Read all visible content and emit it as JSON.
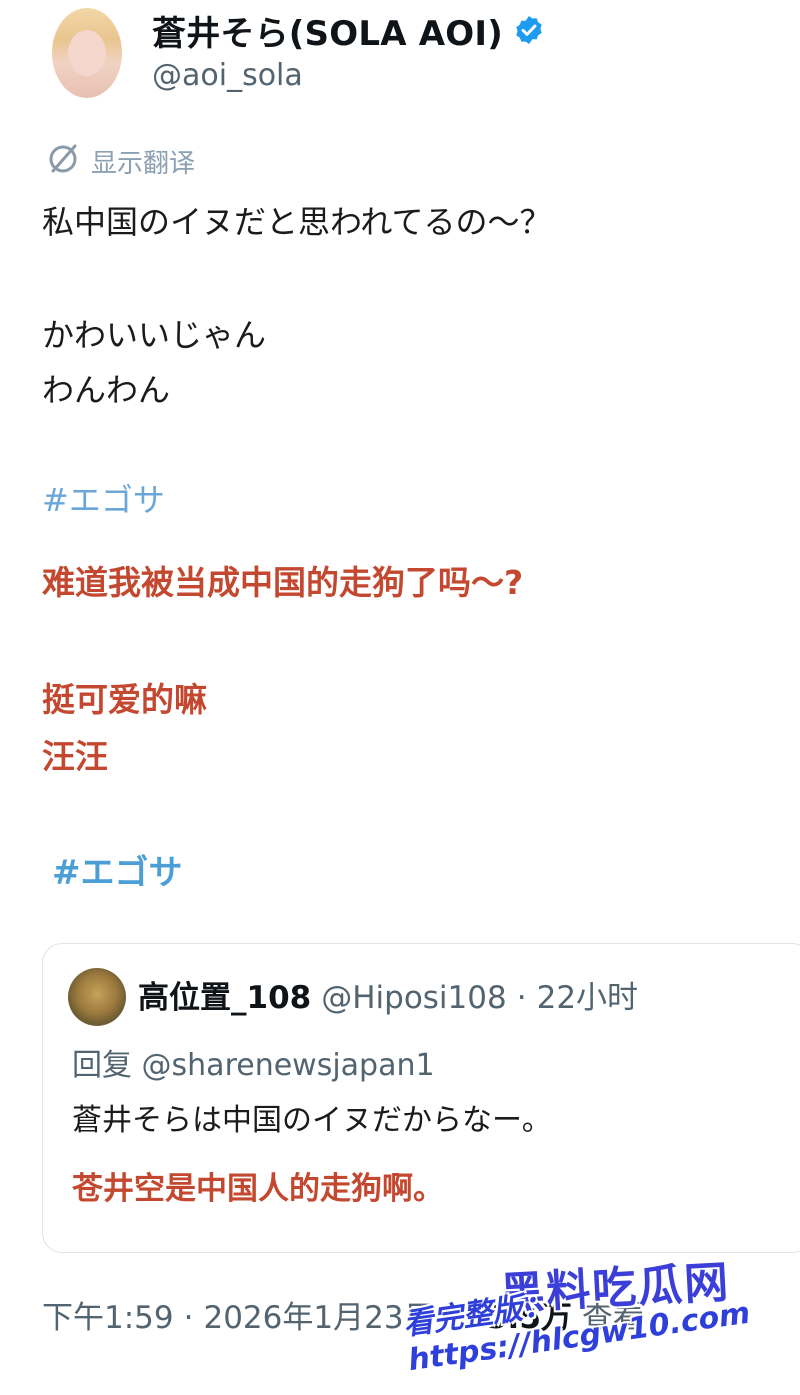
{
  "author": {
    "display_name": "蒼井そら(SOLA AOI)",
    "handle": "@aoi_sola",
    "verified_icon": "verified-badge-icon",
    "accent_color": "#1d9bf0"
  },
  "translate": {
    "icon": "translate-icon",
    "label": "显示翻译"
  },
  "tweet": {
    "line1": "私中国のイヌだと思われてるの〜？",
    "line2": "かわいいじゃん",
    "line3": "わんわん",
    "hashtag": "#エゴサ"
  },
  "translation_overlay": {
    "line1": "难道我被当成中国的走狗了吗～?",
    "line2": "挺可爱的嘛",
    "line3": "汪汪",
    "hashtag": "#エゴサ",
    "color": "#c4482f"
  },
  "quoted": {
    "name": "高位置_108",
    "handle": "@Hiposi108",
    "separator": "·",
    "time": "22小时",
    "reply_label": "回复 @sharenewsjapan1",
    "text": "蒼井そらは中国のイヌだからなー。",
    "translation": "苍井空是中国人的走狗啊。"
  },
  "footer": {
    "time": "下午1:59",
    "sep": "·",
    "date": "2026年1月23日",
    "sep2": "·",
    "views": "15.5万",
    "views_label": "查看"
  },
  "watermark": {
    "site_name": "黑料吃瓜网",
    "url_text": "看完整版：https://hlcgw10.com"
  }
}
